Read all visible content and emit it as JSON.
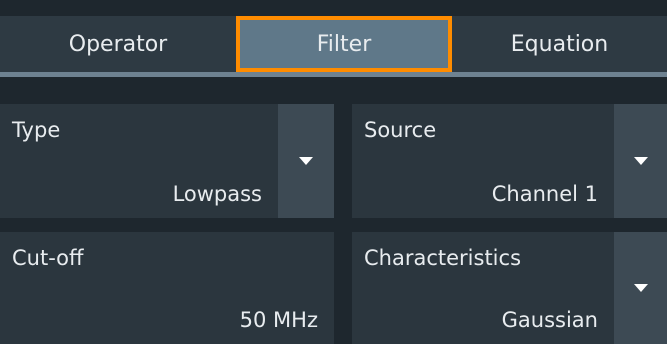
{
  "tabs": [
    {
      "label": "Operator",
      "selected": false
    },
    {
      "label": "Filter",
      "selected": true
    },
    {
      "label": "Equation",
      "selected": false
    }
  ],
  "fields": {
    "type": {
      "label": "Type",
      "value": "Lowpass",
      "has_dropdown": true
    },
    "source": {
      "label": "Source",
      "value": "Channel 1",
      "has_dropdown": true
    },
    "cutoff": {
      "label": "Cut-off",
      "value": "50 MHz",
      "has_dropdown": false
    },
    "characteristics": {
      "label": "Characteristics",
      "value": "Gaussian",
      "has_dropdown": true
    }
  },
  "colors": {
    "background": "#1e272e",
    "tab": "#2e3a43",
    "tab_selected": "#5f7889",
    "tab_selected_border": "#ff8c00",
    "field": "#2b363e",
    "dropdown_button": "#3d4a54"
  }
}
